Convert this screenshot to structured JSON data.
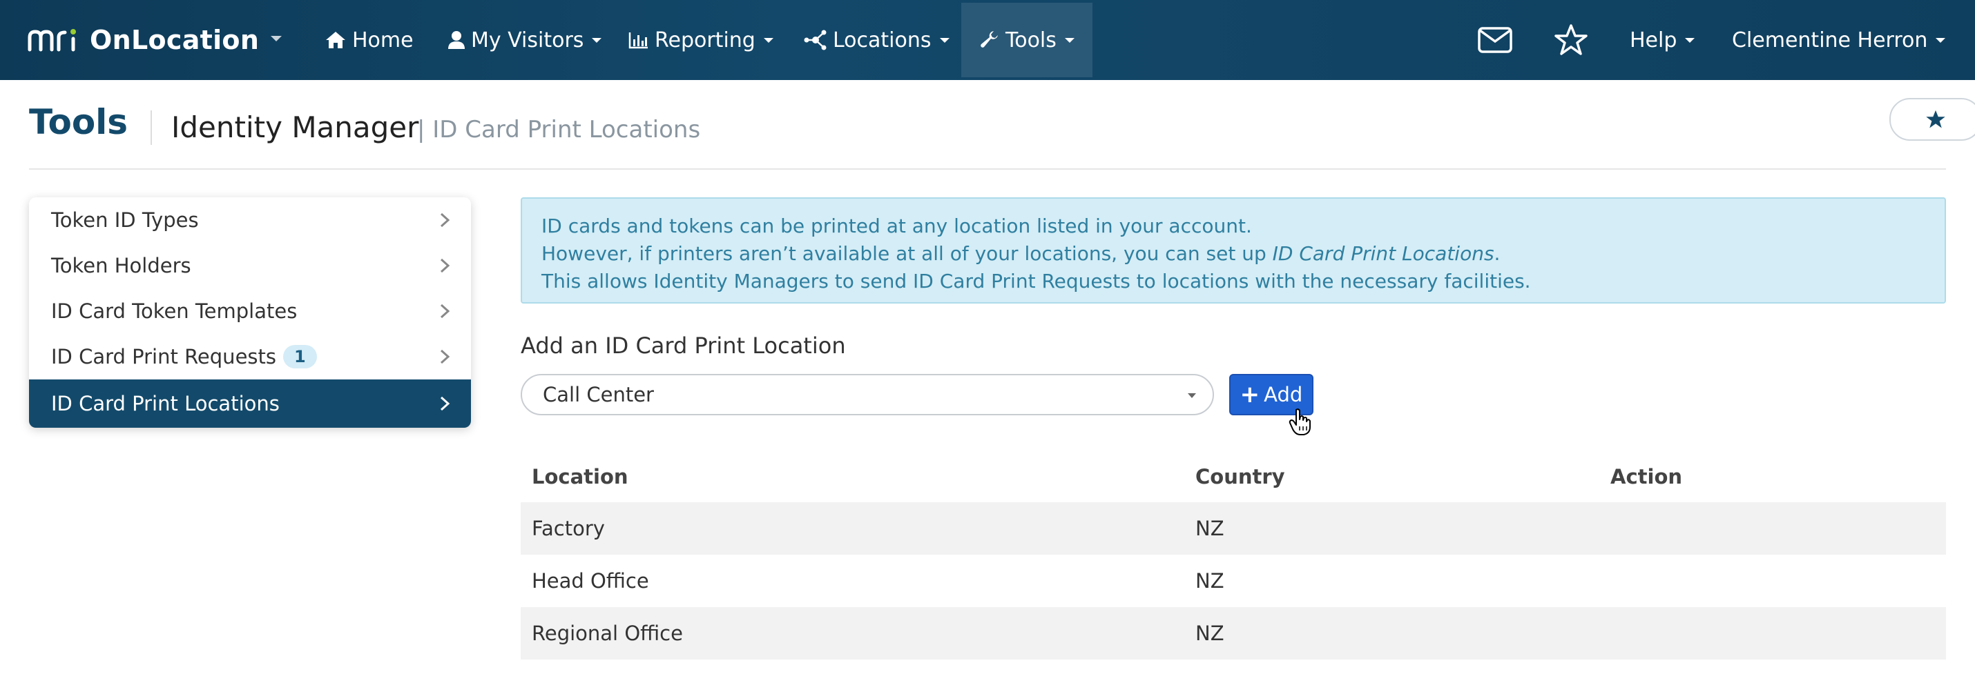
{
  "app": {
    "brand_mark": "mri",
    "brand_name": "OnLocation"
  },
  "nav": {
    "items": [
      {
        "label": "Home",
        "icon": "home-icon"
      },
      {
        "label": "My Visitors",
        "icon": "user-icon"
      },
      {
        "label": "Reporting",
        "icon": "bar-chart-icon"
      },
      {
        "label": "Locations",
        "icon": "network-icon"
      },
      {
        "label": "Tools",
        "icon": "wrench-icon",
        "active": true
      }
    ],
    "right": {
      "help": "Help",
      "user": "Clementine Herron"
    }
  },
  "header": {
    "title": "Tools",
    "subtitle": "Identity Manager",
    "subtitle_detail": "| ID Card Print Locations"
  },
  "sidebar": {
    "items": [
      {
        "label": "Token ID Types"
      },
      {
        "label": "Token Holders"
      },
      {
        "label": "ID Card Token Templates"
      },
      {
        "label": "ID Card Print Requests",
        "badge": "1"
      },
      {
        "label": "ID Card Print Locations",
        "active": true
      }
    ]
  },
  "alert": {
    "line1": "ID cards and tokens can be printed at any location listed in your account.",
    "line2_prefix": "However, if printers aren’t available at all of your locations, you can set up ",
    "line2_emph": "ID Card Print Locations",
    "line2_suffix": ".",
    "line3": "This allows Identity Managers to send ID Card Print Requests to locations with the necessary facilities."
  },
  "add_form": {
    "label": "Add an ID Card Print Location",
    "selected_location": "Call Center",
    "add_button": "Add"
  },
  "table": {
    "headers": [
      "Location",
      "Country",
      "Action"
    ],
    "rows": [
      {
        "location": "Factory",
        "country": "NZ",
        "action": ""
      },
      {
        "location": "Head Office",
        "country": "NZ",
        "action": ""
      },
      {
        "location": "Regional Office",
        "country": "NZ",
        "action": ""
      }
    ]
  },
  "colors": {
    "navbar": "#13486a",
    "title": "#134a6b",
    "sidebar_active": "#134a6b",
    "alert_bg": "#d4edf6",
    "alert_text": "#2f7fa0",
    "add_button": "#2063d4"
  }
}
